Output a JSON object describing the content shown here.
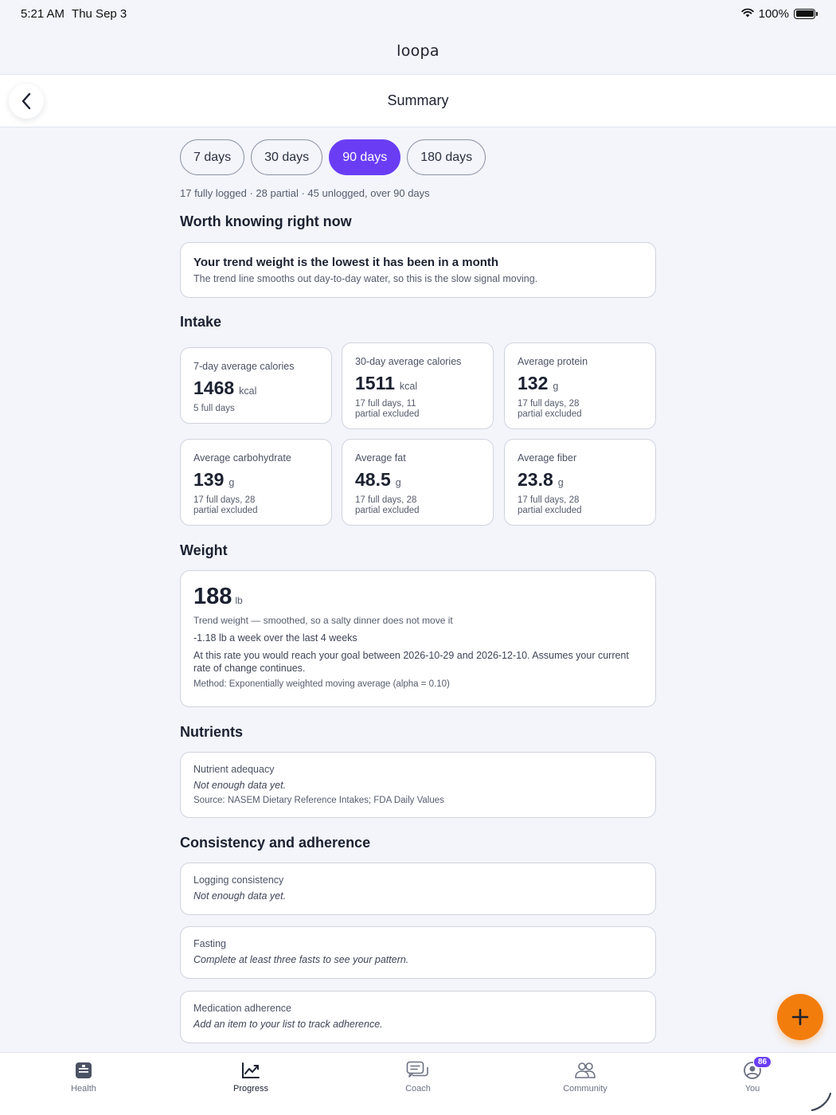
{
  "status_bar": {
    "time": "5:21 AM",
    "date": "Thu Sep 3",
    "battery": "100%"
  },
  "brand": {
    "logo": "loopa"
  },
  "nav": {
    "title": "Summary"
  },
  "range": {
    "chips": [
      "7 days",
      "30 days",
      "90 days",
      "180 days"
    ],
    "selected": "90 days",
    "summary": "17 fully logged · 28 partial · 45 unlogged, over 90 days"
  },
  "insights": {
    "title": "Worth knowing right now",
    "card": {
      "heading": "Your trend weight is the lowest it has been in a month",
      "body": "The trend line smooths out day-to-day water, so this is the slow signal moving."
    }
  },
  "intake": {
    "title": "Intake",
    "metrics": [
      {
        "label": "7-day average calories",
        "value": "1468",
        "unit": "kcal",
        "note": "5 full days"
      },
      {
        "label": "30-day average calories",
        "value": "1511",
        "unit": "kcal",
        "note": "17 full days, 11\npartial excluded"
      },
      {
        "label": "Average protein",
        "value": "132",
        "unit": "g",
        "note": "17 full days, 28\npartial excluded"
      },
      {
        "label": "Average carbohydrate",
        "value": "139",
        "unit": "g",
        "note": "17 full days, 28\npartial excluded"
      },
      {
        "label": "Average fat",
        "value": "48.5",
        "unit": "g",
        "note": "17 full days, 28\npartial excluded"
      },
      {
        "label": "Average fiber",
        "value": "23.8",
        "unit": "g",
        "note": "17 full days, 28\npartial excluded"
      }
    ]
  },
  "weight": {
    "title": "Weight",
    "value": "188",
    "unit": "lb",
    "trend_note": "Trend weight — smoothed, so a salty dinner does not move it",
    "rate": "-1.18 lb a week over the last 4 weeks",
    "projection": "At this rate you would reach your goal between 2026-10-29 and 2026-12-10. Assumes your current rate of change continues.",
    "method": "Method: Exponentially weighted moving average (alpha = 0.10)"
  },
  "nutrients": {
    "title": "Nutrients",
    "label": "Nutrient adequacy",
    "status": "Not enough data yet.",
    "source": "Source: NASEM Dietary Reference Intakes; FDA Daily Values"
  },
  "consistency": {
    "title": "Consistency and adherence",
    "cards": [
      {
        "label": "Logging consistency",
        "status": "Not enough data yet."
      },
      {
        "label": "Fasting",
        "status": "Complete at least three fasts to see your pattern."
      },
      {
        "label": "Medication adherence",
        "status": "Add an item to your list to track adherence."
      }
    ]
  },
  "tabs": {
    "items": [
      "Health",
      "Progress",
      "Coach",
      "Community",
      "You"
    ],
    "active": "Progress",
    "you_badge": "86"
  },
  "colors": {
    "accent": "#6a3df5",
    "fab": "#f27d0c",
    "background": "#f3f5fb"
  }
}
